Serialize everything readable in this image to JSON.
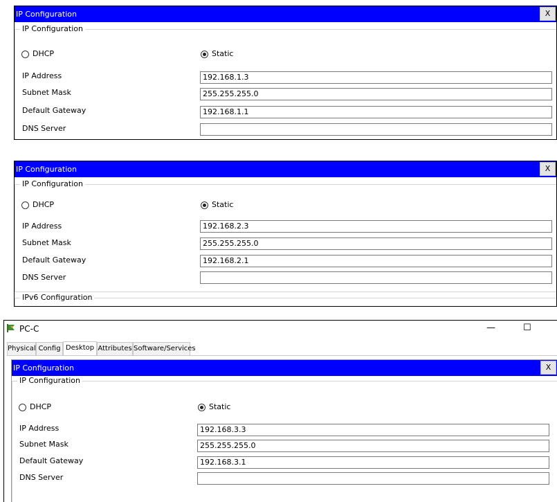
{
  "panels": [
    {
      "title": "IP Configuration",
      "close": "X",
      "section": "IP Configuration",
      "dhcp_label": "DHCP",
      "static_label": "Static",
      "static_selected": true,
      "ip_label": "IP Address",
      "ip_value": "192.168.1.3",
      "mask_label": "Subnet Mask",
      "mask_value": "255.255.255.0",
      "gw_label": "Default Gateway",
      "gw_value": "192.168.1.1",
      "dns_label": "DNS Server",
      "dns_value": ""
    },
    {
      "title": "IP Configuration",
      "close": "X",
      "section": "IP Configuration",
      "dhcp_label": "DHCP",
      "static_label": "Static",
      "static_selected": true,
      "ip_label": "IP Address",
      "ip_value": "192.168.2.3",
      "mask_label": "Subnet Mask",
      "mask_value": "255.255.255.0",
      "gw_label": "Default Gateway",
      "gw_value": "192.168.2.1",
      "dns_label": "DNS Server",
      "dns_value": "",
      "ipv6_section": "IPv6 Configuration"
    },
    {
      "title": "IP Configuration",
      "close": "X",
      "section": "IP Configuration",
      "dhcp_label": "DHCP",
      "static_label": "Static",
      "static_selected": true,
      "ip_label": "IP Address",
      "ip_value": "192.168.3.3",
      "mask_label": "Subnet Mask",
      "mask_value": "255.255.255.0",
      "gw_label": "Default Gateway",
      "gw_value": "192.168.3.1",
      "dns_label": "DNS Server",
      "dns_value": ""
    }
  ],
  "pc_window": {
    "title": "PC-C",
    "icon": "packet-tracer-pc-icon",
    "minimize": "—",
    "maximize": "☐",
    "tabs": [
      "Physical",
      "Config",
      "Desktop",
      "Attributes",
      "Software/Services"
    ],
    "active_tab": "Desktop"
  },
  "colors": {
    "titlebar": "#0000ff",
    "titlebar_text": "#ffffff"
  }
}
